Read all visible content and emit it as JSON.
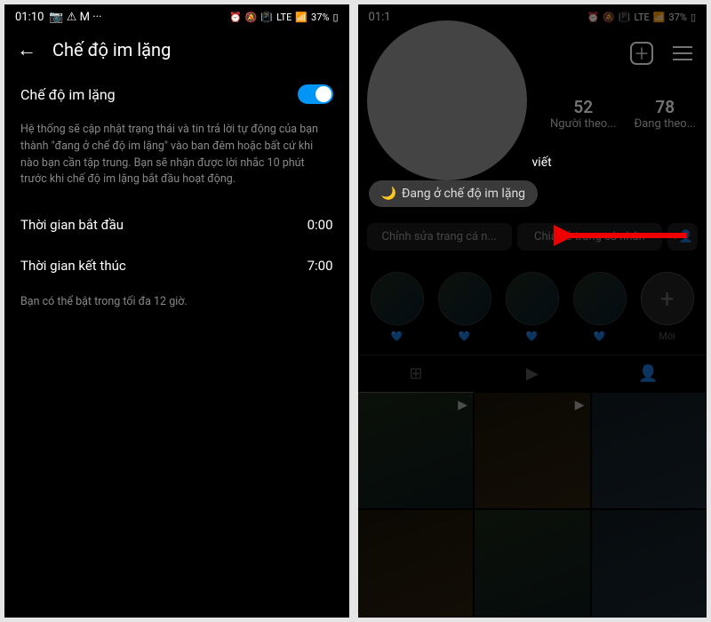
{
  "status": {
    "time": "01:10",
    "icons_left": [
      "📷",
      "⚠",
      "M",
      "•••"
    ],
    "icons_right": "⏰ 🔕 📳 ᴸᵀᴱ 📶 37%🔋",
    "battery": "37%"
  },
  "left": {
    "title": "Chế độ im lặng",
    "toggle_label": "Chế độ im lặng",
    "description": "Hệ thống sẽ cập nhật trạng thái và tin trả lời tự động của bạn thành \"đang ở chế độ im lặng\" vào ban đêm hoặc bất cứ khi nào bạn cần tập trung. Bạn sẽ nhận được lời nhắc 10 phút trước khi chế độ im lặng bắt đầu hoạt động.",
    "start_label": "Thời gian bắt đầu",
    "start_value": "0:00",
    "end_label": "Thời gian kết thúc",
    "end_value": "7:00",
    "hint": "Bạn có thể bật trong tối đa 12 giờ."
  },
  "right": {
    "stats": {
      "posts_label": "viết",
      "followers_num": "52",
      "followers_label": "Người theo...",
      "following_num": "78",
      "following_label": "Đang theo..."
    },
    "quiet_pill": "Đang ở chế độ im lặng",
    "edit_btn": "Chỉnh sửa trang cá n...",
    "share_btn": "Chia sẻ trang cá nhân",
    "highlight_new": "Mới",
    "chevron": "⌄"
  }
}
